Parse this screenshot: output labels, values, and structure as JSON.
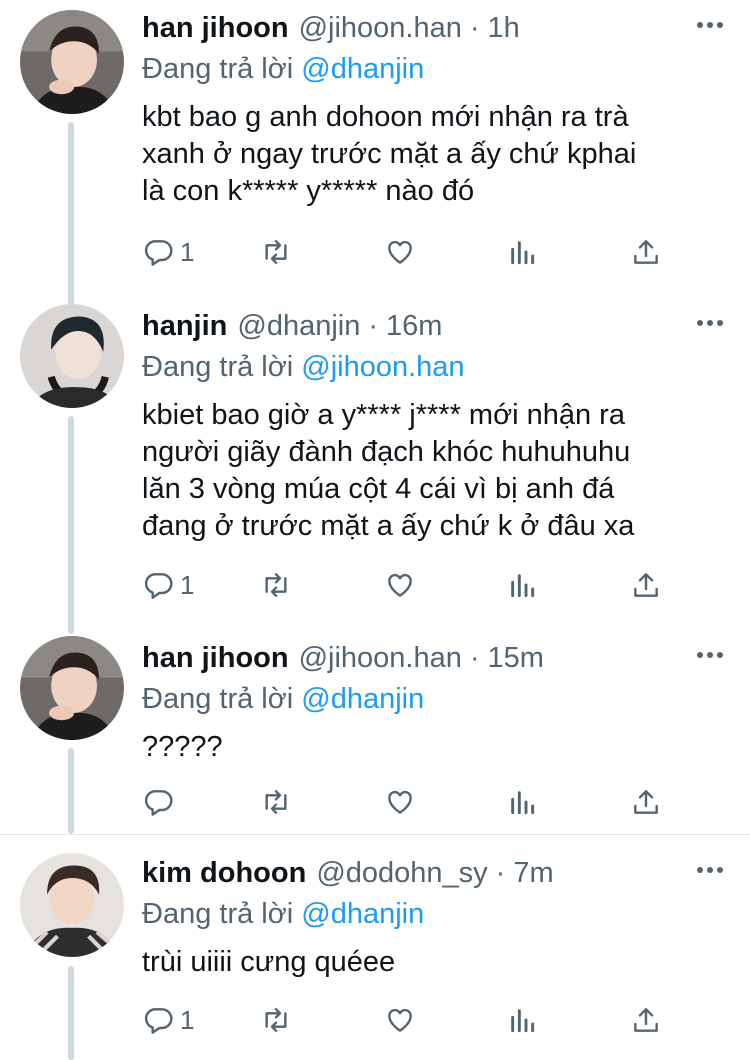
{
  "reply_prefix": "Đang trả lời",
  "tweets": [
    {
      "name": "han jihoon",
      "handle": "@jihoon.han",
      "dot": "·",
      "time": "1h",
      "reply_to": "@dhanjin",
      "text": "kbt bao g anh dohoon mới nhận ra trà\nxanh ở ngay trước mặt a ấy chứ kphai\nlà con k***** y***** nào đó",
      "reply_count": "1",
      "avatar": "avatar-jihoon"
    },
    {
      "name": "hanjin",
      "handle": "@dhanjin",
      "dot": "·",
      "time": "16m",
      "reply_to": "@jihoon.han",
      "text": "kbiet bao giờ a y**** j**** mới nhận ra\nngười giãy đành đạch khóc huhuhuhu\nlăn 3 vòng múa cột 4 cái vì bị anh đá\nđang ở trước mặt a ấy chứ k ở đâu xa",
      "reply_count": "1",
      "avatar": "avatar-hanjin"
    },
    {
      "name": "han jihoon",
      "handle": "@jihoon.han",
      "dot": "·",
      "time": "15m",
      "reply_to": "@dhanjin",
      "text": "?????",
      "reply_count": "",
      "avatar": "avatar-jihoon"
    },
    {
      "name": "kim dohoon",
      "handle": "@dodohn_sy",
      "dot": "·",
      "time": "7m",
      "reply_to": "@dhanjin",
      "text": "trùi uiiii cưng quéee",
      "reply_count": "1",
      "avatar": "avatar-dohoon"
    }
  ],
  "colors": {
    "link": "#1d9bf0",
    "secondary_text": "#536471",
    "thread_line": "#cfd9de"
  },
  "icons": [
    "reply-icon",
    "retweet-icon",
    "like-icon",
    "stats-icon",
    "share-icon",
    "more-icon"
  ]
}
